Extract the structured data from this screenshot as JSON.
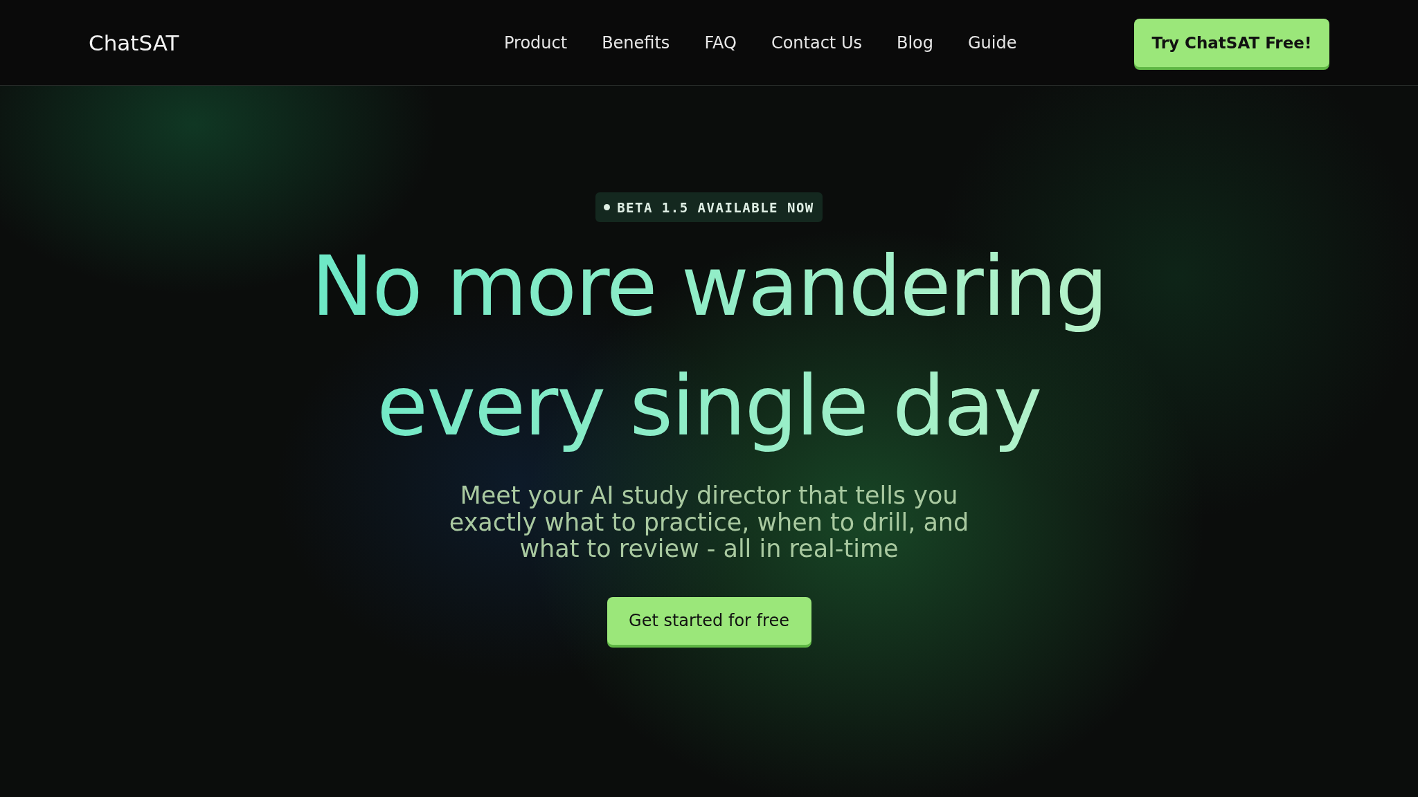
{
  "header": {
    "logo": "ChatSAT",
    "nav": [
      "Product",
      "Benefits",
      "FAQ",
      "Contact Us",
      "Blog",
      "Guide"
    ],
    "cta": "Try ChatSAT Free!"
  },
  "hero": {
    "badge": "BETA 1.5 AVAILABLE NOW",
    "title": [
      "No more wandering",
      "every single day"
    ],
    "subtitle": "Meet your AI study director that tells you exactly what to practice, when to drill, and what to review - all in real-time",
    "button": "Get started for free"
  }
}
